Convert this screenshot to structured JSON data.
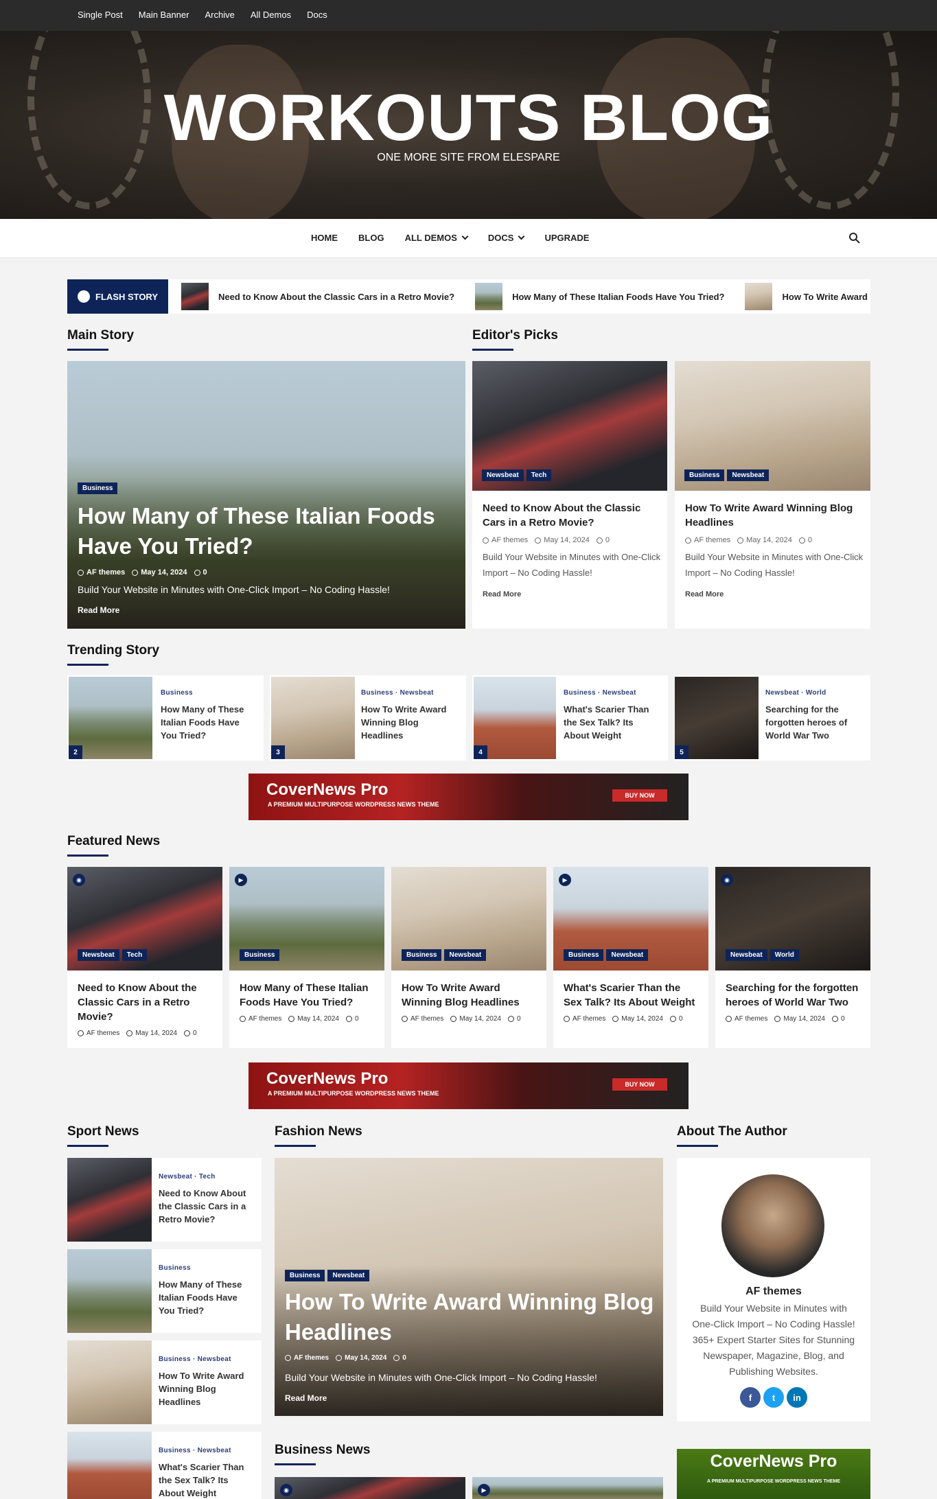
{
  "topbar": {
    "links": [
      "Single Post",
      "Main Banner",
      "Archive",
      "All Demos",
      "Docs"
    ]
  },
  "site": {
    "title": "WORKOUTS BLOG",
    "tagline": "ONE MORE SITE FROM ELESPARE"
  },
  "nav": {
    "home": "HOME",
    "blog": "BLOG",
    "all_demos": "ALL DEMOS",
    "docs": "DOCS",
    "upgrade": "UPGRADE"
  },
  "flash": {
    "label": "FLASH STORY",
    "items": [
      "Need to Know About the Classic Cars in a Retro Movie?",
      "How Many of These Italian Foods Have You Tried?",
      "How To Write Award Winning Blog Headlines"
    ]
  },
  "sections": {
    "main_story": "Main Story",
    "editors_picks": "Editor's Picks",
    "trending": "Trending Story",
    "featured": "Featured News",
    "sport": "Sport News",
    "fashion": "Fashion News",
    "about": "About The Author",
    "business": "Business News"
  },
  "common": {
    "author": "AF themes",
    "date": "May 14, 2024",
    "comments": "0",
    "read_more": "Read More",
    "excerpt": "Build Your Website in Minutes with One-Click Import – No Coding Hassle!"
  },
  "main_story": {
    "tag": "Business",
    "title": "How Many of These Italian Foods Have You Tried?"
  },
  "editors": [
    {
      "tags": [
        "Newsbeat",
        "Tech"
      ],
      "title": "Need to Know About the Classic Cars in a Retro Movie?"
    },
    {
      "tags": [
        "Business",
        "Newsbeat"
      ],
      "title": "How To Write Award Winning Blog Headlines"
    }
  ],
  "trending": [
    {
      "cats": "Business",
      "title": "How Many of These Italian Foods Have You Tried?",
      "num": "2"
    },
    {
      "cats": "Business · Newsbeat",
      "title": "How To Write Award Winning Blog Headlines",
      "num": "3"
    },
    {
      "cats": "Business · Newsbeat",
      "title": "What's Scarier Than the Sex Talk? Its About Weight",
      "num": "4"
    },
    {
      "cats": "Newsbeat · World",
      "title": "Searching for the forgotten heroes of World War Two",
      "num": "5"
    }
  ],
  "ad": {
    "title": "CoverNews Pro",
    "subtitle": "A PREMIUM MULTIPURPOSE WORDPRESS NEWS THEME",
    "button": "BUY NOW"
  },
  "featured": [
    {
      "tags": [
        "Newsbeat",
        "Tech"
      ],
      "title": "Need to Know About the Classic Cars in a Retro Movie?"
    },
    {
      "tags": [
        "Business"
      ],
      "title": "How Many of These Italian Foods Have You Tried?"
    },
    {
      "tags": [
        "Business",
        "Newsbeat"
      ],
      "title": "How To Write Award Winning Blog Headlines"
    },
    {
      "tags": [
        "Business",
        "Newsbeat"
      ],
      "title": "What's Scarier Than the Sex Talk? Its About Weight"
    },
    {
      "tags": [
        "Newsbeat",
        "World"
      ],
      "title": "Searching for the forgotten heroes of World War Two"
    }
  ],
  "sport": [
    {
      "cats": "Newsbeat · Tech",
      "title": "Need to Know About the Classic Cars in a Retro Movie?"
    },
    {
      "cats": "Business",
      "title": "How Many of These Italian Foods Have You Tried?"
    },
    {
      "cats": "Business · Newsbeat",
      "title": "How To Write Award Winning Blog Headlines"
    },
    {
      "cats": "Business · Newsbeat",
      "title": "What's Scarier Than the Sex Talk? Its About Weight"
    }
  ],
  "fashion": {
    "tags": [
      "Business",
      "Newsbeat"
    ],
    "title": "How To Write Award Winning Blog Headlines"
  },
  "author": {
    "name": "AF themes",
    "bio": "Build Your Website in Minutes with One-Click Import – No Coding Hassle! 365+ Expert Starter Sites for Stunning Newspaper, Magazine, Blog, and Publishing Websites.",
    "socials": [
      "f",
      "t",
      "in"
    ]
  },
  "colors": {
    "accent": "#0e2459",
    "facebook": "#3b5998",
    "twitter": "#1da1f2",
    "linkedin": "#0077b5"
  }
}
